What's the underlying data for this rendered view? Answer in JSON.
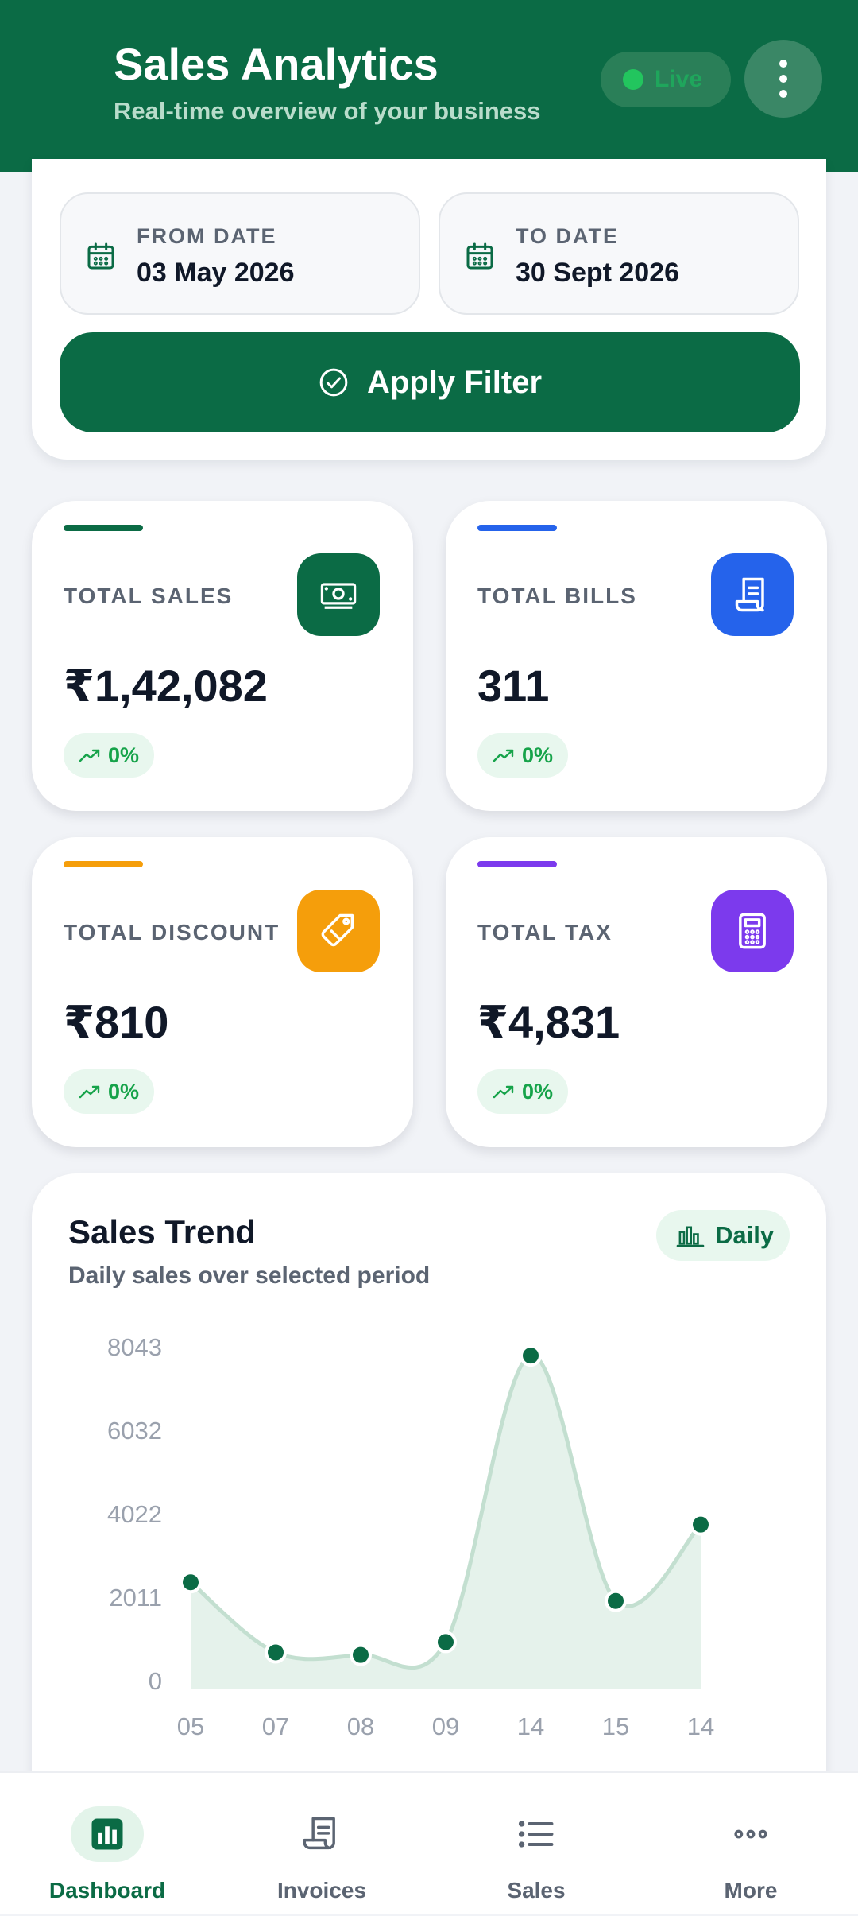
{
  "header": {
    "title": "Sales Analytics",
    "subtitle": "Real-time overview of your business",
    "live_label": "Live",
    "menu_icon": "more-vertical-icon"
  },
  "filter": {
    "from_label": "FROM DATE",
    "from_value": "03 May 2026",
    "to_label": "TO DATE",
    "to_value": "30 Sept 2026",
    "apply_label": "Apply Filter"
  },
  "stats": [
    {
      "label": "TOTAL SALES",
      "value": "₹1,42,082",
      "change": "0%",
      "color": "#0b6b45",
      "icon": "cash-icon"
    },
    {
      "label": "TOTAL BILLS",
      "value": "311",
      "change": "0%",
      "color": "#2563eb",
      "icon": "receipt-icon"
    },
    {
      "label": "TOTAL DISCOUNT",
      "value": "₹810",
      "change": "0%",
      "color": "#f59e0b",
      "icon": "tag-icon"
    },
    {
      "label": "TOTAL TAX",
      "value": "₹4,831",
      "change": "0%",
      "color": "#7c3aed",
      "icon": "calculator-icon"
    }
  ],
  "chart": {
    "title": "Sales Trend",
    "subtitle": "Daily sales over selected period",
    "mode_label": "Daily"
  },
  "chart_data": {
    "type": "area",
    "categories": [
      "05",
      "07",
      "08",
      "09",
      "14",
      "15",
      "14"
    ],
    "values": [
      2370,
      680,
      620,
      930,
      7830,
      1920,
      3760
    ],
    "yticks": [
      "0",
      "2011",
      "4022",
      "6032",
      "8043"
    ],
    "ylim": [
      0,
      8043
    ],
    "grid": false,
    "line_color": "#c3dfd0",
    "fill_color": "#e5f2eb",
    "point_color": "#0b6b45"
  },
  "nav": [
    {
      "label": "Dashboard",
      "icon": "bar-chart-icon",
      "active": true
    },
    {
      "label": "Invoices",
      "icon": "invoice-icon",
      "active": false
    },
    {
      "label": "Sales",
      "icon": "list-icon",
      "active": false
    },
    {
      "label": "More",
      "icon": "more-horizontal-icon",
      "active": false
    }
  ],
  "colors": {
    "brand": "#0b6b45",
    "positive": "#16a34a"
  }
}
